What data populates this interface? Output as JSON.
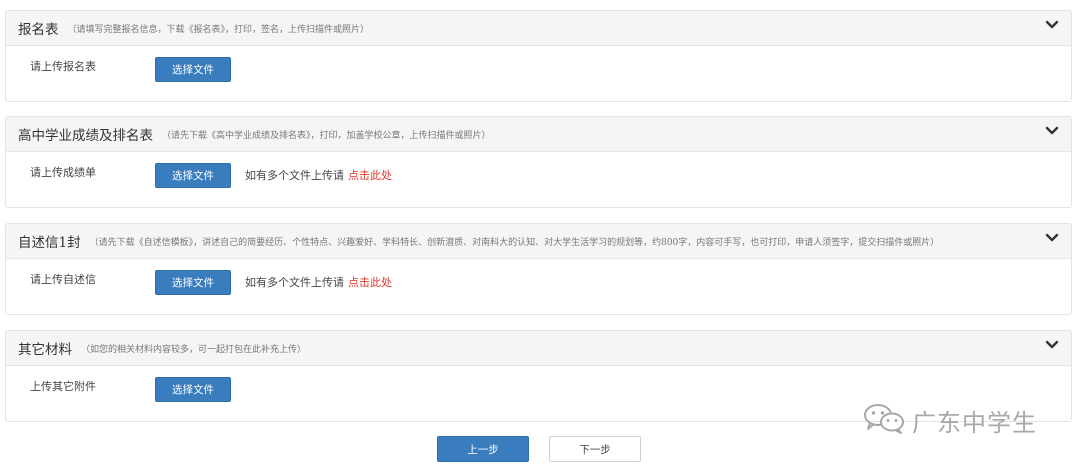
{
  "sections": [
    {
      "title": "报名表",
      "hint": "（请填写完整报名信息，下载《报名表》，打印，签名，上传扫描件或照片）",
      "field_label": "请上传报名表",
      "button_label": "选择文件"
    },
    {
      "title": "高中学业成绩及排名表",
      "hint": "（请先下载《高中学业成绩及排名表》，打印，加盖学校公章，上传扫描件或照片）",
      "field_label": "请上传成绩单",
      "button_label": "选择文件",
      "multi_text": "如有多个文件上传请",
      "multi_link": "点击此处"
    },
    {
      "title": "自述信1封",
      "hint": "（请先下载《自述信模板》，讲述自己的简要经历、个性特点、兴趣爱好、学科特长、创新潜质、对南科大的认知、对大学生活学习的规划等，约800字，内容可手写，也可打印，申请人须签字，提交扫描件或照片）",
      "field_label": "请上传自述信",
      "button_label": "选择文件",
      "multi_text": "如有多个文件上传请",
      "multi_link": "点击此处"
    },
    {
      "title": "其它材料",
      "hint": "（如您的相关材料内容较多，可一起打包在此补充上传）",
      "field_label": "上传其它附件",
      "button_label": "选择文件"
    }
  ],
  "nav": {
    "prev_label": "上一步",
    "next_label": "下一步"
  },
  "watermark": {
    "text": "广东中学生",
    "icon": "wechat-icon"
  },
  "colors": {
    "primary": "#3a7dbf",
    "link": "#e0352b",
    "header_bg": "#f5f5f5"
  }
}
